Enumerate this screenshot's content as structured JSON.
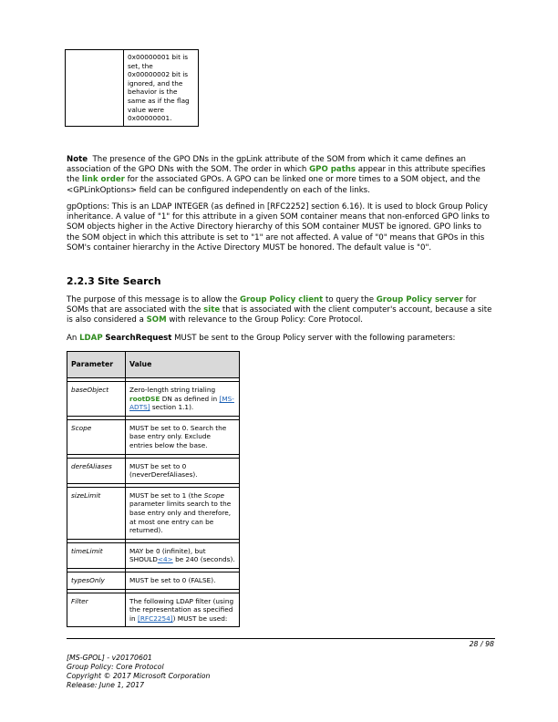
{
  "continuation_table": {
    "cell_text": "0x00000001 bit is set, the 0x00000002 bit is ignored, and the behavior is the same as if the flag value were 0x00000001."
  },
  "note": {
    "label": "Note",
    "t1": "The presence of the GPO DNs in the gpLink attribute of the SOM from which it came defines an association of the GPO DNs with the SOM. The order in which ",
    "k1": "GPO paths",
    "t2": " appear in this attribute specifies the ",
    "k2": "link order",
    "t3": " for the associated GPOs. A GPO can be linked one or more times to a SOM object, and the <GPLinkOptions> field can be configured independently on each of the links."
  },
  "gpoptions": {
    "text": "gpOptions: This is an LDAP INTEGER (as defined in [RFC2252] section 6.16). It is used to block Group Policy inheritance. A value of \"1\" for this attribute in a given SOM container means that non-enforced GPO links to SOM objects higher in the Active Directory hierarchy of this SOM container MUST be ignored. GPO links to the SOM object in which this attribute is set to \"1\" are not affected. A value of \"0\" means that GPOs in this SOM's container hierarchy in the Active Directory MUST be honored. The default value is \"0\"."
  },
  "section": {
    "number": "2.2.3",
    "title": "Site Search"
  },
  "purpose": {
    "t1": "The purpose of this message is to allow the ",
    "k1": "Group Policy client",
    "t2": " to query the ",
    "k2": "Group Policy server",
    "t3": " for SOMs that are associated with the ",
    "k3": "site",
    "t4": " that is associated with the client computer's account, because a site is also considered a ",
    "k4": "SOM",
    "t5": " with relevance to the Group Policy: Core Protocol."
  },
  "ldap": {
    "k1": "LDAP",
    "t0": "An ",
    "b1": "SearchRequest",
    "t1": " MUST be sent to the Group Policy server with the following parameters:"
  },
  "params_table": {
    "header": {
      "parameter": "Parameter",
      "value": "Value"
    },
    "rows": [
      {
        "name": "baseObject",
        "v1": "Zero-length string trialing ",
        "v2": "rootDSE",
        "v3": " DN as defined in ",
        "v4": "[MS-ADTS]",
        "v5": " section 1.1)."
      },
      {
        "name": "Scope",
        "value": "MUST be set to 0. Search the base entry only. Exclude entries below the base."
      },
      {
        "name": "derefAliases",
        "value": "MUST be set to 0 (neverDerefAliases)."
      },
      {
        "name": "sizeLimit",
        "v1": "MUST be set to 1 (the ",
        "v2": "Scope",
        "v3": " parameter limits search to the base entry only and therefore, at most one entry can be returned)."
      },
      {
        "name": "timeLimit",
        "v1": "MAY be 0 (infinite), but SHOULD",
        "v2": "<4>",
        "v3": " be 240 (seconds)."
      },
      {
        "name": "typesOnly",
        "value": "MUST be set to 0 (FALSE)."
      },
      {
        "name": "Filter",
        "v1": "The following LDAP filter (using the representation as specified in ",
        "v2": "[RFC2254]",
        "v3": ") MUST be used:"
      }
    ]
  },
  "footer": {
    "page": "28 / 98",
    "line1": "[MS-GPOL] - v20170601",
    "line2": "Group Policy: Core Protocol",
    "line3": "Copyright © 2017 Microsoft Corporation",
    "line4": "Release: June 1, 2017"
  },
  "colors": {
    "keyword_green": "#2e8b1e",
    "link_blue": "#1a5fb4",
    "header_gray": "#d9d9d9"
  }
}
